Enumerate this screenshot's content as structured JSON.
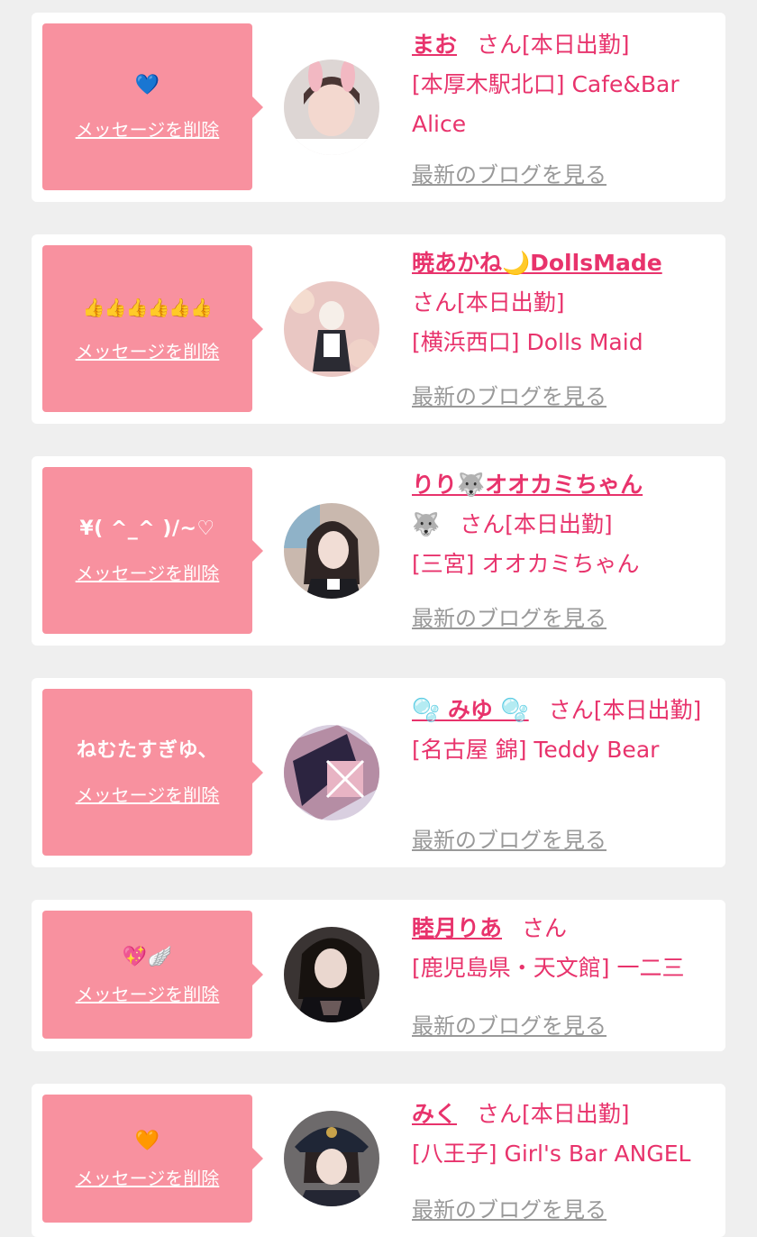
{
  "delete_label": "メッセージを削除",
  "blog_label": "最新のブログを見る",
  "colors": {
    "bubble": "#f8919f",
    "accent": "#e8336c",
    "muted": "#999999",
    "card": "#ffffff",
    "background": "#efefef"
  },
  "items": [
    {
      "message": "💙",
      "name": "まお",
      "suffix": "さん",
      "status": "[本日出勤]",
      "shop": "[本厚木駅北口] Cafe&Bar Alice"
    },
    {
      "message": "👍👍👍👍👍👍",
      "name": "暁あかね🌙DollsMade",
      "suffix": "さん",
      "status": "[本日出勤]",
      "shop": "[横浜西口] Dolls Maid"
    },
    {
      "message": "¥( ^_^ )/~♡",
      "name": "りり🐺オオカミちゃん",
      "name_extra": "🐺",
      "suffix": "さん",
      "status": "[本日出勤]",
      "shop": "[三宮] オオカミちゃん"
    },
    {
      "message": "ねむたすぎゆ、",
      "name": "🫧 みゆ 🫧",
      "suffix": "さん",
      "status": "[本日出勤]",
      "shop": "[名古屋 錦] Teddy Bear"
    },
    {
      "message": "💖🪽",
      "name": "睦月りあ",
      "suffix": "さん",
      "status": "",
      "shop": "[鹿児島県・天文館] 一二三"
    },
    {
      "message": "🧡",
      "name": "みく",
      "suffix": "さん",
      "status": "[本日出勤]",
      "shop": "[八王子] Girl's Bar ANGEL"
    }
  ]
}
